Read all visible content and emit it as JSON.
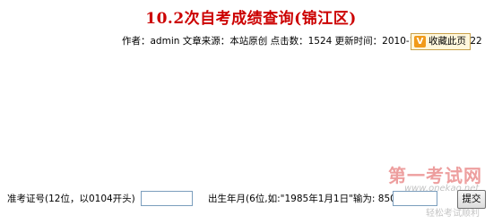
{
  "page": {
    "title": "10.2次自考成绩查询(锦江区)"
  },
  "meta": {
    "author": "作者：admin",
    "source": "文章来源：本站原创",
    "clicks": "点击数：1524",
    "updated": "更新时间：2010-11-22 13:39:22"
  },
  "favorite": {
    "icon": "V",
    "label": "收藏此页"
  },
  "form": {
    "id_label": "准考证号(12位，以0104开头)",
    "id_value": "",
    "birth_label": "出生年月(6位,如:\"1985年1月1日\"输为: 850101)",
    "birth_value": "",
    "submit_label": "提交"
  },
  "watermark": {
    "main": "第一考试网",
    "url": "www.onekao.net",
    "sub": "轻松考试顺利"
  }
}
